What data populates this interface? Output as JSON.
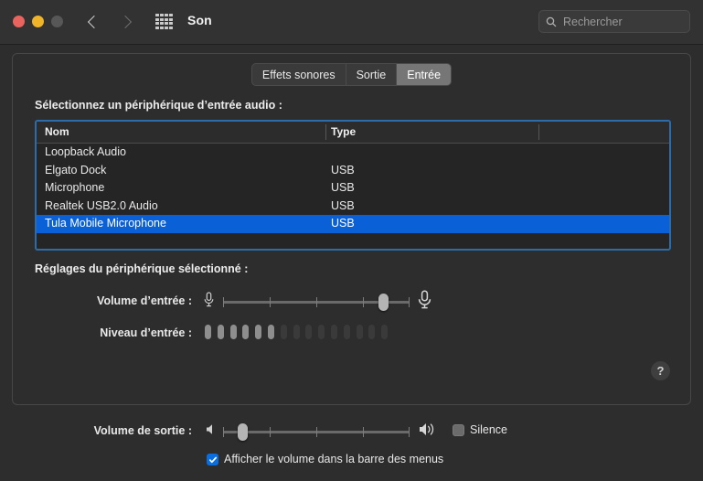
{
  "window": {
    "title": "Son",
    "traffic_lights": [
      "close-red",
      "minimize-yellow",
      "zoom-gray-disabled"
    ]
  },
  "toolbar": {
    "back_icon": "chevron-left-icon",
    "forward_icon": "chevron-right-icon",
    "grid_icon": "grid-apps-icon",
    "search": {
      "icon": "search-icon",
      "placeholder": "Rechercher",
      "value": ""
    }
  },
  "tabs": [
    {
      "label": "Effets sonores",
      "active": false
    },
    {
      "label": "Sortie",
      "active": false
    },
    {
      "label": "Entrée",
      "active": true
    }
  ],
  "input_pane": {
    "select_device_label": "Sélectionnez un périphérique d’entrée audio :",
    "table": {
      "columns": [
        "Nom",
        "Type"
      ],
      "rows": [
        {
          "name": "Loopback Audio",
          "type": "",
          "selected": false
        },
        {
          "name": "Elgato Dock",
          "type": "USB",
          "selected": false
        },
        {
          "name": "Microphone",
          "type": "USB",
          "selected": false
        },
        {
          "name": "Realtek USB2.0 Audio",
          "type": "USB",
          "selected": false
        },
        {
          "name": "Tula Mobile Microphone",
          "type": "USB",
          "selected": true
        }
      ]
    },
    "settings_label": "Réglages du périphérique sélectionné :",
    "input_volume": {
      "label": "Volume d’entrée :",
      "left_icon": "microphone-small-icon",
      "right_icon": "microphone-large-icon",
      "value_percent": 86,
      "ticks": 5
    },
    "input_level": {
      "label": "Niveau d’entrée :",
      "segments_total": 15,
      "segments_lit": 6
    },
    "help_button": {
      "icon": "question-mark-icon",
      "label": "?"
    }
  },
  "output_row": {
    "output_volume": {
      "label": "Volume de sortie :",
      "left_icon": "speaker-mute-icon",
      "right_icon": "speaker-loud-icon",
      "value_percent": 10,
      "ticks": 5
    },
    "mute": {
      "label": "Silence",
      "checked": false
    },
    "menubar_toggle": {
      "label": "Afficher le volume dans la barre des menus",
      "checked": true
    }
  },
  "colors": {
    "window_bg": "#2d2d2d",
    "titlebar_bg": "#323232",
    "panel_border": "#474747",
    "table_bg": "#252525",
    "table_focus_ring": "#2d6ca8",
    "selection_blue": "#0a60d6",
    "accent_checkbox": "#0a6ee0",
    "tab_active_bg": "#767676",
    "text_primary": "#e8e8e8",
    "text_muted": "#9a9a9a"
  }
}
